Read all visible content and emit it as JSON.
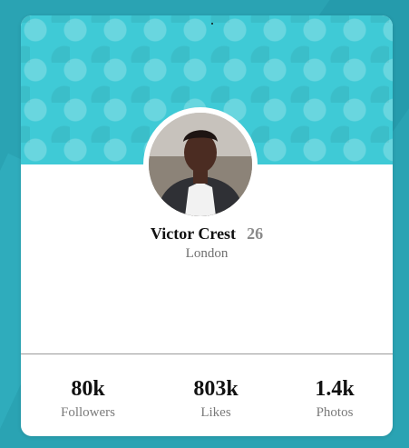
{
  "profile": {
    "name": "Victor Crest",
    "age": "26",
    "city": "London"
  },
  "stats": [
    {
      "value": "80k",
      "label": "Followers"
    },
    {
      "value": "803k",
      "label": "Likes"
    },
    {
      "value": "1.4k",
      "label": "Photos"
    }
  ],
  "colors": {
    "background": "#2aa3b3",
    "banner": "#3fcad6",
    "card": "#ffffff",
    "name_text": "#111111",
    "secondary_text": "#7a7a7a"
  }
}
